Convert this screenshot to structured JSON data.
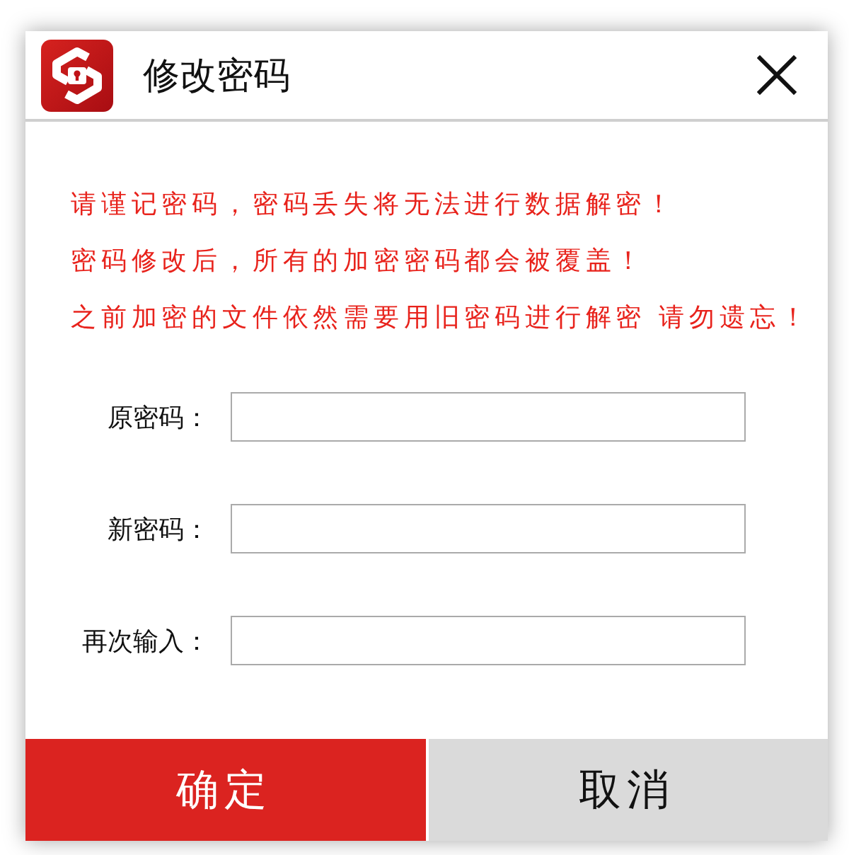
{
  "window": {
    "title": "修改密码"
  },
  "warnings": [
    "请谨记密码，密码丢失将无法进行数据解密！",
    "密码修改后，所有的加密密码都会被覆盖！",
    "之前加密的文件依然需要用旧密码进行解密 请勿遗忘！"
  ],
  "fields": [
    {
      "label": "原密码："
    },
    {
      "label": "新密码："
    },
    {
      "label": "再次输入："
    }
  ],
  "buttons": [
    {
      "label": "确定",
      "kind": "primary"
    },
    {
      "label": "取消",
      "kind": "secondary"
    }
  ]
}
